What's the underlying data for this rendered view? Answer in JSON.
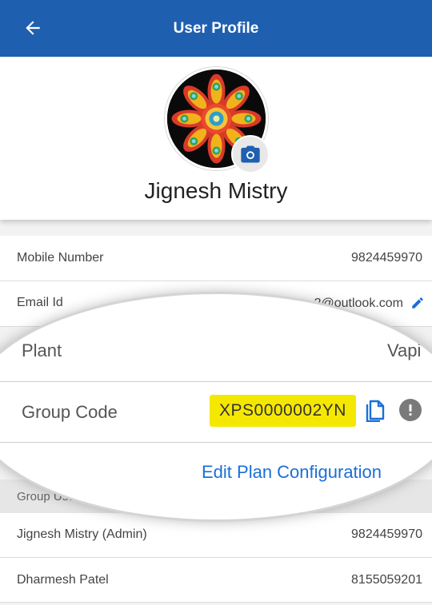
{
  "header": {
    "title": "User Profile",
    "back_icon": "arrow-left-icon",
    "color": "#1f5fb0"
  },
  "profile": {
    "name": "Jignesh Mistry",
    "camera_icon": "camera-icon"
  },
  "details": {
    "mobile": {
      "label": "Mobile Number",
      "value": "9824459970"
    },
    "email": {
      "label": "Email Id",
      "value": "2@outlook.com",
      "edit_icon": "pencil-icon"
    }
  },
  "zoom": {
    "plant": {
      "label": "Plant",
      "value": "Vapi"
    },
    "group_code": {
      "label": "Group Code",
      "value": "XPS0000002YN",
      "highlight": "#f5e800",
      "copy_icon": "copy-icon",
      "info_icon": "info-icon"
    },
    "edit_plan": "Edit Plan Configuration"
  },
  "group_users": {
    "header": "Group Users",
    "users": [
      {
        "name": "Jignesh Mistry (Admin)",
        "phone": "9824459970"
      },
      {
        "name": "Dharmesh Patel",
        "phone": "8155059201"
      }
    ]
  }
}
